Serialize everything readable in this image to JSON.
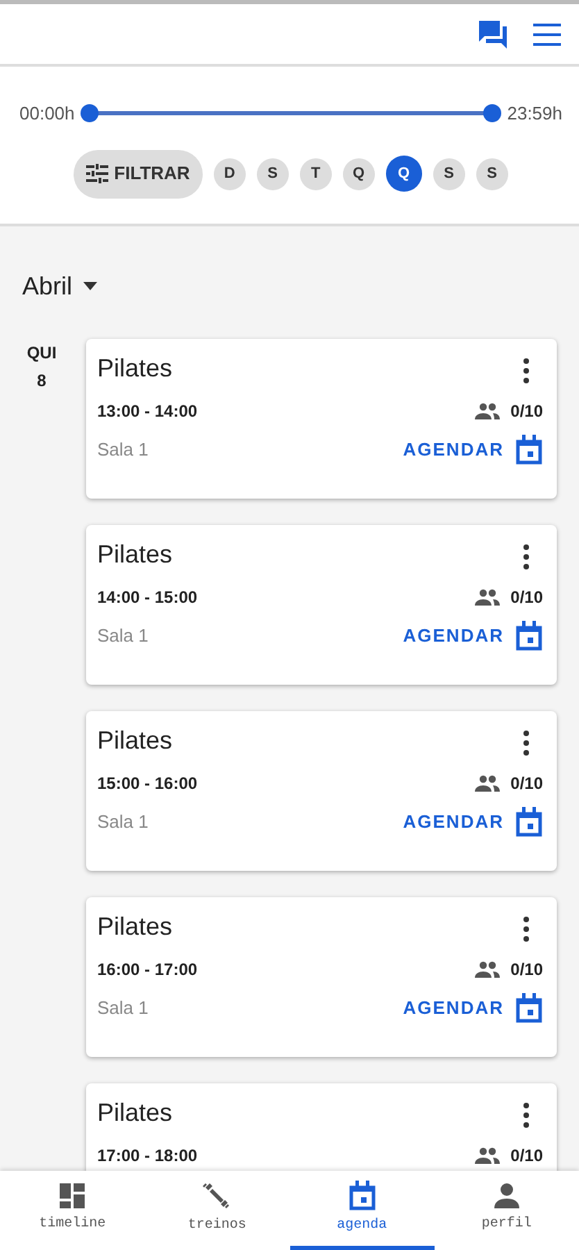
{
  "time_filter": {
    "start": "00:00h",
    "end": "23:59h",
    "level": 1
  },
  "filter_button": {
    "label": "FILTRAR"
  },
  "days": [
    {
      "label": "D",
      "selected": false
    },
    {
      "label": "S",
      "selected": false
    },
    {
      "label": "T",
      "selected": false
    },
    {
      "label": "Q",
      "selected": false
    },
    {
      "label": "Q",
      "selected": true
    },
    {
      "label": "S",
      "selected": false
    },
    {
      "label": "S",
      "selected": false
    }
  ],
  "month": "Abril",
  "date": {
    "weekday": "QUI",
    "day": "8"
  },
  "classes": [
    {
      "title": "Pilates",
      "time": "13:00 - 14:00",
      "spots": "0/10",
      "room": "Sala 1",
      "action": "AGENDAR"
    },
    {
      "title": "Pilates",
      "time": "14:00 - 15:00",
      "spots": "0/10",
      "room": "Sala 1",
      "action": "AGENDAR"
    },
    {
      "title": "Pilates",
      "time": "15:00 - 16:00",
      "spots": "0/10",
      "room": "Sala 1",
      "action": "AGENDAR"
    },
    {
      "title": "Pilates",
      "time": "16:00 - 17:00",
      "spots": "0/10",
      "room": "Sala 1",
      "action": "AGENDAR"
    },
    {
      "title": "Pilates",
      "time": "17:00 - 18:00",
      "spots": "0/10"
    }
  ],
  "bottom_nav": [
    {
      "label": "timeline",
      "selected": false
    },
    {
      "label": "treinos",
      "selected": false
    },
    {
      "label": "agenda",
      "selected": true
    },
    {
      "label": "perfil",
      "selected": false
    }
  ]
}
